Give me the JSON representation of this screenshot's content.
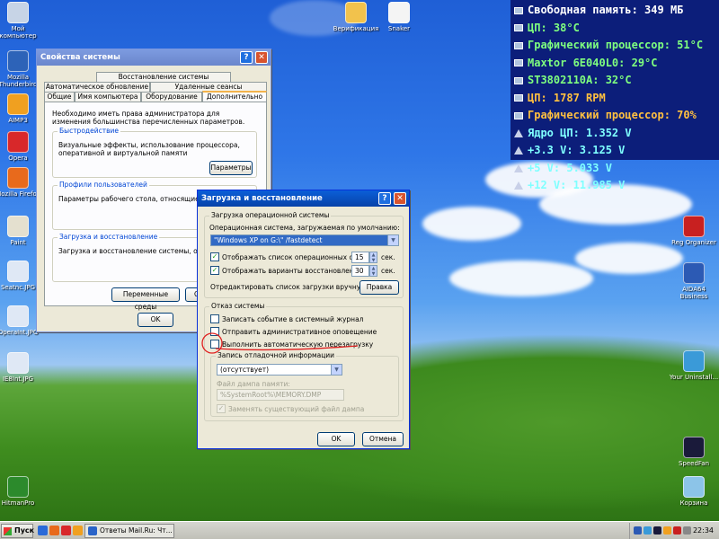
{
  "desktop_icons": [
    {
      "label": "Мой компьютер",
      "icon": "my-computer-icon",
      "color": "#c7d4e6"
    },
    {
      "label": "Mozilla Thunderbird",
      "icon": "thunderbird-icon",
      "color": "#2d63b8"
    },
    {
      "label": "AIMP3",
      "icon": "aimp-icon",
      "color": "#f0a020"
    },
    {
      "label": "Opera",
      "icon": "opera-icon",
      "color": "#d8282a"
    },
    {
      "label": "Mozilla Firefox",
      "icon": "firefox-icon",
      "color": "#e86a1c"
    },
    {
      "label": "Paint",
      "icon": "paint-icon",
      "color": "#e4e0cf"
    },
    {
      "label": "Seatnc.JPG",
      "icon": "image-file-icon",
      "color": "#dfe8f5"
    },
    {
      "label": "OperaInt.JPG",
      "icon": "image-file-icon",
      "color": "#dfe8f5"
    },
    {
      "label": "IE8Int.JPG",
      "icon": "image-file-icon",
      "color": "#dfe8f5"
    },
    {
      "label": "HitmanPro",
      "icon": "hitmanpro-icon",
      "color": "#2c8a2c"
    },
    {
      "label": "Верификация",
      "icon": "verification-icon",
      "color": "#f2c24c"
    },
    {
      "label": "Snaker",
      "icon": "snaker-icon",
      "color": "#f4f4f4"
    },
    {
      "label": "Reg Organizer",
      "icon": "reg-organizer-icon",
      "color": "#c82020"
    },
    {
      "label": "AIDA64 Business",
      "icon": "aida64-icon",
      "color": "#2c5ab4"
    },
    {
      "label": "Your Uninstall...",
      "icon": "uninstaller-icon",
      "color": "#3a9ad8"
    },
    {
      "label": "SpeedFan",
      "icon": "speedfan-icon",
      "color": "#1a1a3a"
    },
    {
      "label": "Корзина",
      "icon": "recycle-bin-icon",
      "color": "#8cc4e8"
    }
  ],
  "sensors": [
    {
      "label": "Свободная память: 349 МБ",
      "color": "#ffffff",
      "icon": "memory-icon"
    },
    {
      "label": "ЦП: 38°C",
      "color": "#7fff7f",
      "icon": "cpu-icon"
    },
    {
      "label": "Графический процессор: 51°C",
      "color": "#7fff7f",
      "icon": "gpu-icon"
    },
    {
      "label": "Maxtor 6E040L0: 29°C",
      "color": "#7fff7f",
      "icon": "hdd-icon"
    },
    {
      "label": "ST3802110A: 32°C",
      "color": "#7fff7f",
      "icon": "hdd-icon"
    },
    {
      "label": "ЦП: 1787 RPM",
      "color": "#ffc040",
      "icon": "fan-icon"
    },
    {
      "label": "Графический процессор: 70%",
      "color": "#ffc040",
      "icon": "gpu-load-icon"
    },
    {
      "label": "Ядро ЦП: 1.352 V",
      "color": "#7fffff",
      "icon": "voltage-icon"
    },
    {
      "label": "+3.3 V: 3.125 V",
      "color": "#7fffff",
      "icon": "voltage-icon"
    },
    {
      "label": "+5 V: 5.033 V",
      "color": "#7fffff",
      "icon": "voltage-icon"
    },
    {
      "label": "+12 V: 11.985 V",
      "color": "#7fffff",
      "icon": "voltage-icon"
    }
  ],
  "sysprops": {
    "title": "Свойства системы",
    "tabs_top": [
      "Восстановление системы"
    ],
    "tabs_mid": [
      "Автоматическое обновление",
      "Удаленные сеансы"
    ],
    "tabs_bottom": [
      "Общие",
      "Имя компьютера",
      "Оборудование",
      "Дополнительно"
    ],
    "admin_note": "Необходимо иметь права администратора для изменения большинства перечисленных параметров.",
    "perf_group": "Быстродействие",
    "perf_text": "Визуальные эффекты, использование процессора, оперативной и виртуальной памяти",
    "params_button": "Параметры",
    "profiles_group": "Профили пользователей",
    "profiles_text": "Параметры рабочего стола, относящиеся ко вхо",
    "boot_group": "Загрузка и восстановление",
    "boot_text": "Загрузка и восстановление системы, отладочна",
    "env_button": "Переменные среды",
    "ok": "OK",
    "cancel_partial": "О"
  },
  "bootrec": {
    "title": "Загрузка и восстановление",
    "os_group": "Загрузка операционной системы",
    "default_os_label": "Операционная система, загружаемая по умолчанию:",
    "default_os_value": "\"Windows XP on G:\\\" /fastdetect",
    "show_os_list": "Отображать список операционных систем:",
    "show_os_seconds": "15",
    "show_recovery": "Отображать варианты восстановления:",
    "recovery_seconds": "30",
    "sec": "сек.",
    "edit_label": "Отредактировать список загрузки вручную:",
    "edit_button": "Правка",
    "failure_group": "Отказ системы",
    "log_event": "Записать событие в системный журнал",
    "send_alert": "Отправить административное оповещение",
    "auto_restart": "Выполнить автоматическую перезагрузку",
    "debug_group": "Запись отладочной информации",
    "debug_value": "(отсутствует)",
    "dump_label": "Файл дампа памяти:",
    "dump_path": "%SystemRoot%\\MEMORY.DMP",
    "overwrite": "Заменять существующий файл дампа",
    "ok": "OK",
    "cancel": "Отмена",
    "check": "✓"
  },
  "taskbar": {
    "start": "Пуск",
    "task": "Ответы Mail.Ru: Чт...",
    "clock": "22:34"
  }
}
